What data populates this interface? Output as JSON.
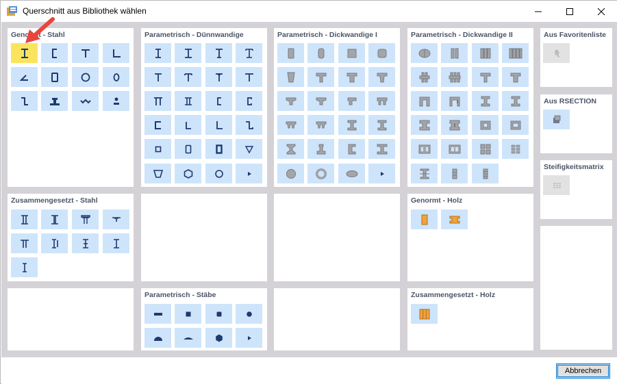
{
  "window": {
    "title": "Querschnitt aus Bibliothek wählen",
    "minimize_icon": "minimize-icon",
    "maximize_icon": "maximize-icon",
    "close_icon": "close-icon"
  },
  "panels": {
    "genormt_stahl": {
      "title": "Genormt - Stahl"
    },
    "dunnwandige": {
      "title": "Parametrisch - Dünnwandige"
    },
    "dickwandige1": {
      "title": "Parametrisch - Dickwandige I"
    },
    "dickwandige2": {
      "title": "Parametrisch - Dickwandige II"
    },
    "favoriten": {
      "title": "Aus Favoritenliste"
    },
    "rsection": {
      "title": "Aus RSECTION"
    },
    "steifigkeit": {
      "title": "Steifigkeitsmatrix"
    },
    "zusammen_stahl": {
      "title": "Zusammengesetzt - Stahl"
    },
    "genormt_holz": {
      "title": "Genormt - Holz"
    },
    "staebe": {
      "title": "Parametrisch - Stäbe"
    },
    "zusammen_holz": {
      "title": "Zusammengesetzt - Holz"
    }
  },
  "footer": {
    "cancel_label": "Abbrechen"
  },
  "colors": {
    "cell_bg": "#cde4fb",
    "selected_bg": "#fbe45d",
    "panel_title": "#4c5468",
    "glyph": "#1e3a6e",
    "arrow": "#e8453c",
    "wood": "#f0a33e"
  }
}
